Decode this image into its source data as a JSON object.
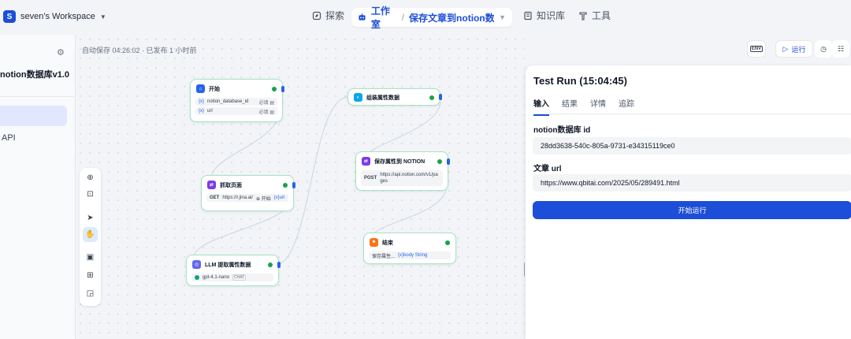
{
  "workspace": {
    "logo_letter": "S",
    "name": "seven's Workspace"
  },
  "nav": {
    "explore": "探索",
    "studio": "工作室",
    "app_name": "保存文章到notion数...",
    "knowledge": "知识库",
    "tools": "工具"
  },
  "sidebar": {
    "app_title": "notion数据库v1.0",
    "api_item": "API"
  },
  "canvas": {
    "autosave": "自动保存 04:26:02 · 已发布 1 小时前",
    "nodes": {
      "start": {
        "title": "开始",
        "vars": [
          {
            "name": "notion_database_id",
            "tag": "必填 ▤"
          },
          {
            "name": "url",
            "tag": "必填 ▤"
          }
        ]
      },
      "fetch": {
        "title": "抓取页面",
        "method": "GET",
        "url": "https://r.jina.ai/",
        "var_src": "⊕ 开始",
        "var": "{x}url"
      },
      "llm": {
        "title": "LLM 提取属性数据",
        "model": "gpt-4.1-nano",
        "tag": "CHAT"
      },
      "assemble": {
        "title": "组装属性数据"
      },
      "save": {
        "title": "保存属性到 NOTION",
        "method": "POST",
        "url": "https://api.notion.com/v1/pages"
      },
      "end": {
        "title": "结束",
        "var_src": "保存属性...",
        "var": "{x}body String"
      }
    }
  },
  "run_toolbar": {
    "env": "ENV",
    "run": "运行"
  },
  "panel": {
    "title": "Test Run (15:04:45)",
    "tabs": [
      "输入",
      "结果",
      "详情",
      "追踪"
    ],
    "field1_label": "notion数据库 id",
    "field1_value": "28dd3638-540c-805a-9731-e34315119ce0",
    "field2_label": "文章 url",
    "field2_value": "https://www.qbitai.com/2025/05/289491.html",
    "start_run": "开始运行"
  },
  "colors": {
    "accent": "#1d4ed8",
    "success": "#16a34a",
    "node_border": "#a7e3c1"
  }
}
